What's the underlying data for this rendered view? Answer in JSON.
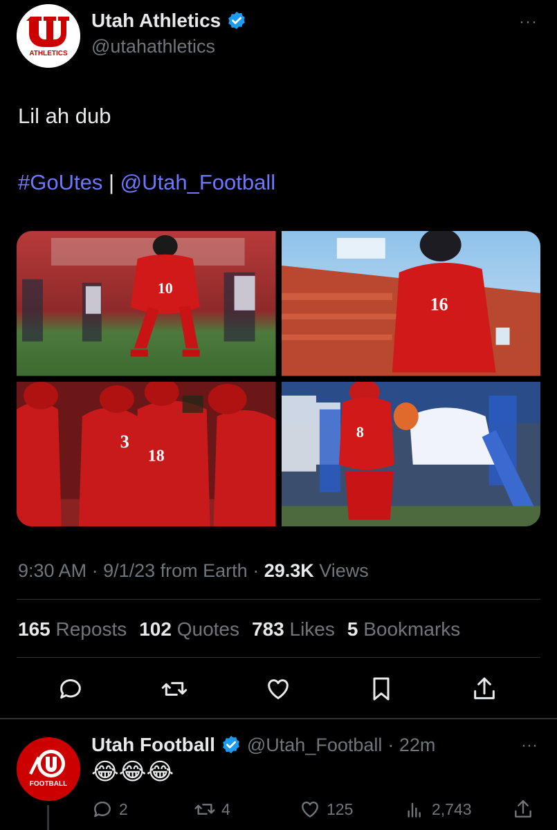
{
  "tweet": {
    "author": {
      "display_name": "Utah Athletics",
      "handle": "@utahathletics",
      "avatar_text": "ATHLETICS",
      "verified": true
    },
    "more_label": "···",
    "text": "Lil ah dub",
    "hashtag": "#GoUtes",
    "separator": " | ",
    "mention": "@Utah_Football",
    "photos": [
      {
        "name": "photo-player-10-running"
      },
      {
        "name": "photo-player-celebrating-stadium"
      },
      {
        "name": "photo-team-celebration"
      },
      {
        "name": "photo-player-8-kneeling"
      }
    ],
    "meta": {
      "time": "9:30 AM",
      "dot1": " · ",
      "date": "9/1/23",
      "source": " from Earth",
      "dot2": " · ",
      "views_count": "29.3K",
      "views_label": " Views"
    },
    "stats": {
      "reposts_count": "165",
      "reposts_label": "Reposts",
      "quotes_count": "102",
      "quotes_label": "Quotes",
      "likes_count": "783",
      "likes_label": "Likes",
      "bookmarks_count": "5",
      "bookmarks_label": "Bookmarks"
    }
  },
  "reply": {
    "author": {
      "display_name": "Utah Football",
      "handle": "@Utah_Football",
      "time": "· 22m",
      "avatar_text": "FOOTBALL",
      "verified": true
    },
    "more_label": "···",
    "text": "😂😂😂",
    "replies": "2",
    "reposts": "4",
    "likes": "125",
    "views": "2,743"
  },
  "colors": {
    "background": "#000000",
    "link": "#6f77ff",
    "verified": "#1d9bf0",
    "utah_red": "#cc0000",
    "muted": "#71767b"
  }
}
